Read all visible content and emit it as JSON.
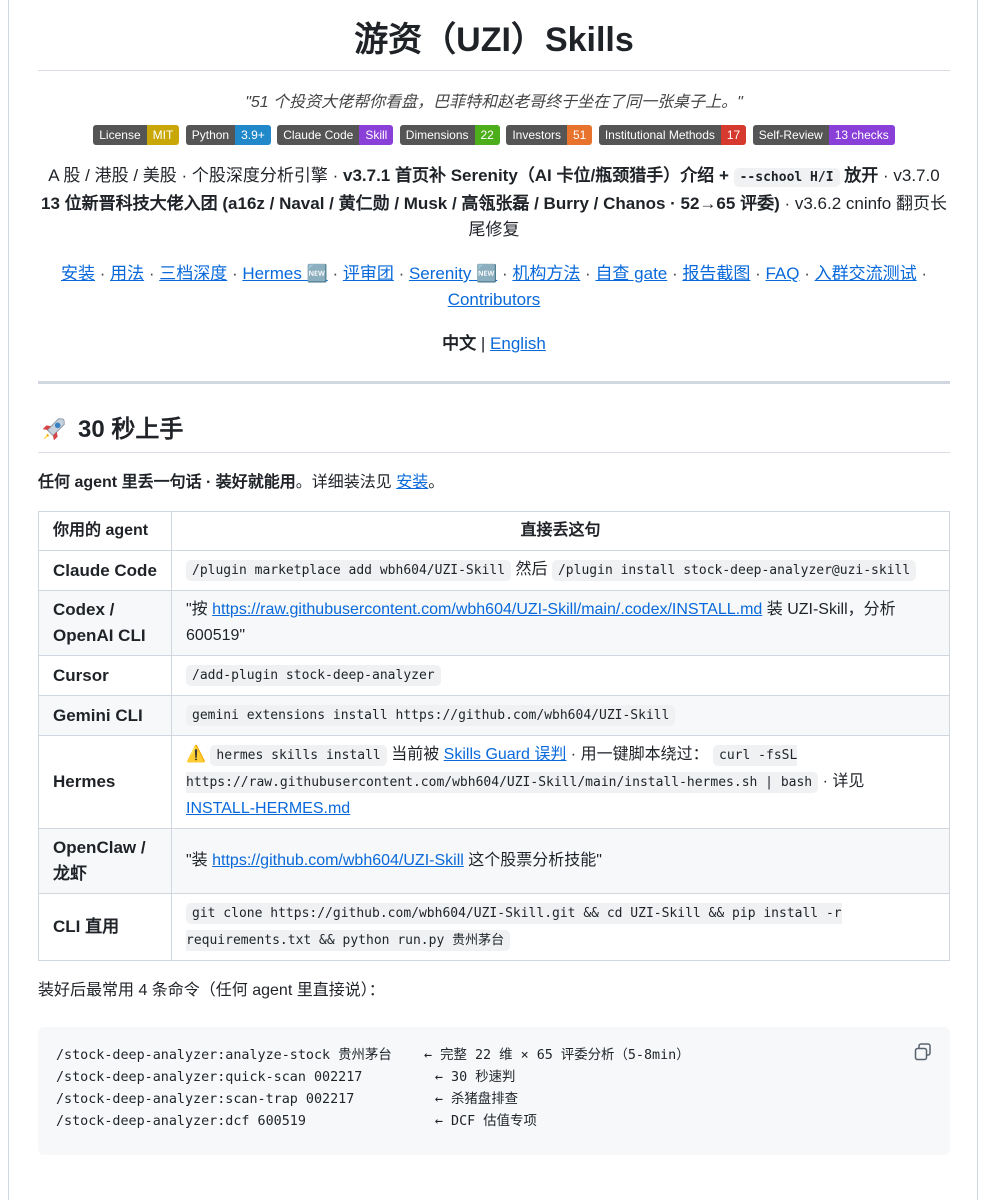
{
  "title": "游资（UZI）Skills",
  "quote": "\"51 个投资大佬帮你看盘，巴菲特和赵老哥终于坐在了同一张桌子上。\"",
  "badges": [
    {
      "key": "License",
      "value": "MIT",
      "color": "#c9a707"
    },
    {
      "key": "Python",
      "value": "3.9+",
      "color": "#2188c9"
    },
    {
      "key": "Claude Code",
      "value": "Skill",
      "color": "#8a3fd9"
    },
    {
      "key": "Dimensions",
      "value": "22",
      "color": "#4cae1a"
    },
    {
      "key": "Investors",
      "value": "51",
      "color": "#e7732c"
    },
    {
      "key": "Institutional Methods",
      "value": "17",
      "color": "#d63a2e"
    },
    {
      "key": "Self-Review",
      "value": "13 checks",
      "color": "#8a3fd9"
    }
  ],
  "intro": {
    "p1": "A 股 / 港股 / 美股 · 个股深度分析引擎 · ",
    "p2": "v3.7.1 首页补 Serenity（AI 卡位/瓶颈猎手）介绍 + ",
    "code": "--school H/I",
    "p3": " 放开",
    "p4": " · v3.7.0 ",
    "p5": "13 位新晋科技大佬入团 (a16z / Naval / 黄仁勋 / Musk / 高瓴张磊 / Burry / Chanos · 52→65 评委)",
    "p6": " · v3.6.2 cninfo 翻页长尾修复"
  },
  "nav": [
    "安装",
    "用法",
    "三档深度",
    "Hermes 🆕",
    "评审团",
    "Serenity 🆕",
    "机构方法",
    "自查 gate",
    "报告截图",
    "FAQ",
    "入群交流测试",
    "Contributors"
  ],
  "lang": {
    "zh": "中文",
    "sep": " | ",
    "en": "English"
  },
  "section": {
    "emoji_name": "rocket-icon",
    "title": "30 秒上手"
  },
  "lead": {
    "bold": "任何 agent 里丢一句话 · 装好就能用",
    "rest": "。详细装法见 ",
    "link": "安装",
    "end": "。"
  },
  "table": {
    "headers": [
      "你用的 agent",
      "直接丢这句"
    ],
    "rows": {
      "claude": {
        "agent": "Claude Code",
        "code1": "/plugin marketplace add wbh604/UZI-Skill",
        "mid": " 然后 ",
        "code2": "/plugin install stock-deep-analyzer@uzi-skill"
      },
      "codex": {
        "agent": "Codex / OpenAI CLI",
        "pre": "\"按 ",
        "link": "https://raw.githubusercontent.com/wbh604/UZI-Skill/main/.codex/INSTALL.md",
        "post": " 装 UZI-Skill，分析 600519\""
      },
      "cursor": {
        "agent": "Cursor",
        "code": "/add-plugin stock-deep-analyzer"
      },
      "gemini": {
        "agent": "Gemini CLI",
        "code": "gemini extensions install https://github.com/wbh604/UZI-Skill"
      },
      "hermes": {
        "agent": "Hermes",
        "warn": "⚠️",
        "code1": "hermes skills install",
        "t1": " 当前被 ",
        "link1": "Skills Guard 误判",
        "t2": " · 用一键脚本绕过： ",
        "code2": "curl -fsSL https://raw.githubusercontent.com/wbh604/UZI-Skill/main/install-hermes.sh | bash",
        "t3": " · 详见 ",
        "link2": "INSTALL-HERMES.md"
      },
      "openclaw": {
        "agent": "OpenClaw / 龙虾",
        "pre": "\"装 ",
        "link": "https://github.com/wbh604/UZI-Skill",
        "post": " 这个股票分析技能\""
      },
      "cli": {
        "agent": "CLI 直用",
        "code": "git clone https://github.com/wbh604/UZI-Skill.git && cd UZI-Skill && pip install -r requirements.txt && python run.py 贵州茅台"
      }
    }
  },
  "after": "装好后最常用 4 条命令（任何 agent 里直接说）：",
  "commands": [
    "/stock-deep-analyzer:analyze-stock 贵州茅台    ← 完整 22 维 × 65 评委分析（5-8min）",
    "/stock-deep-analyzer:quick-scan 002217         ← 30 秒速判",
    "/stock-deep-analyzer:scan-trap 002217          ← 杀猪盘排查",
    "/stock-deep-analyzer:dcf 600519                ← DCF 估值专项"
  ]
}
